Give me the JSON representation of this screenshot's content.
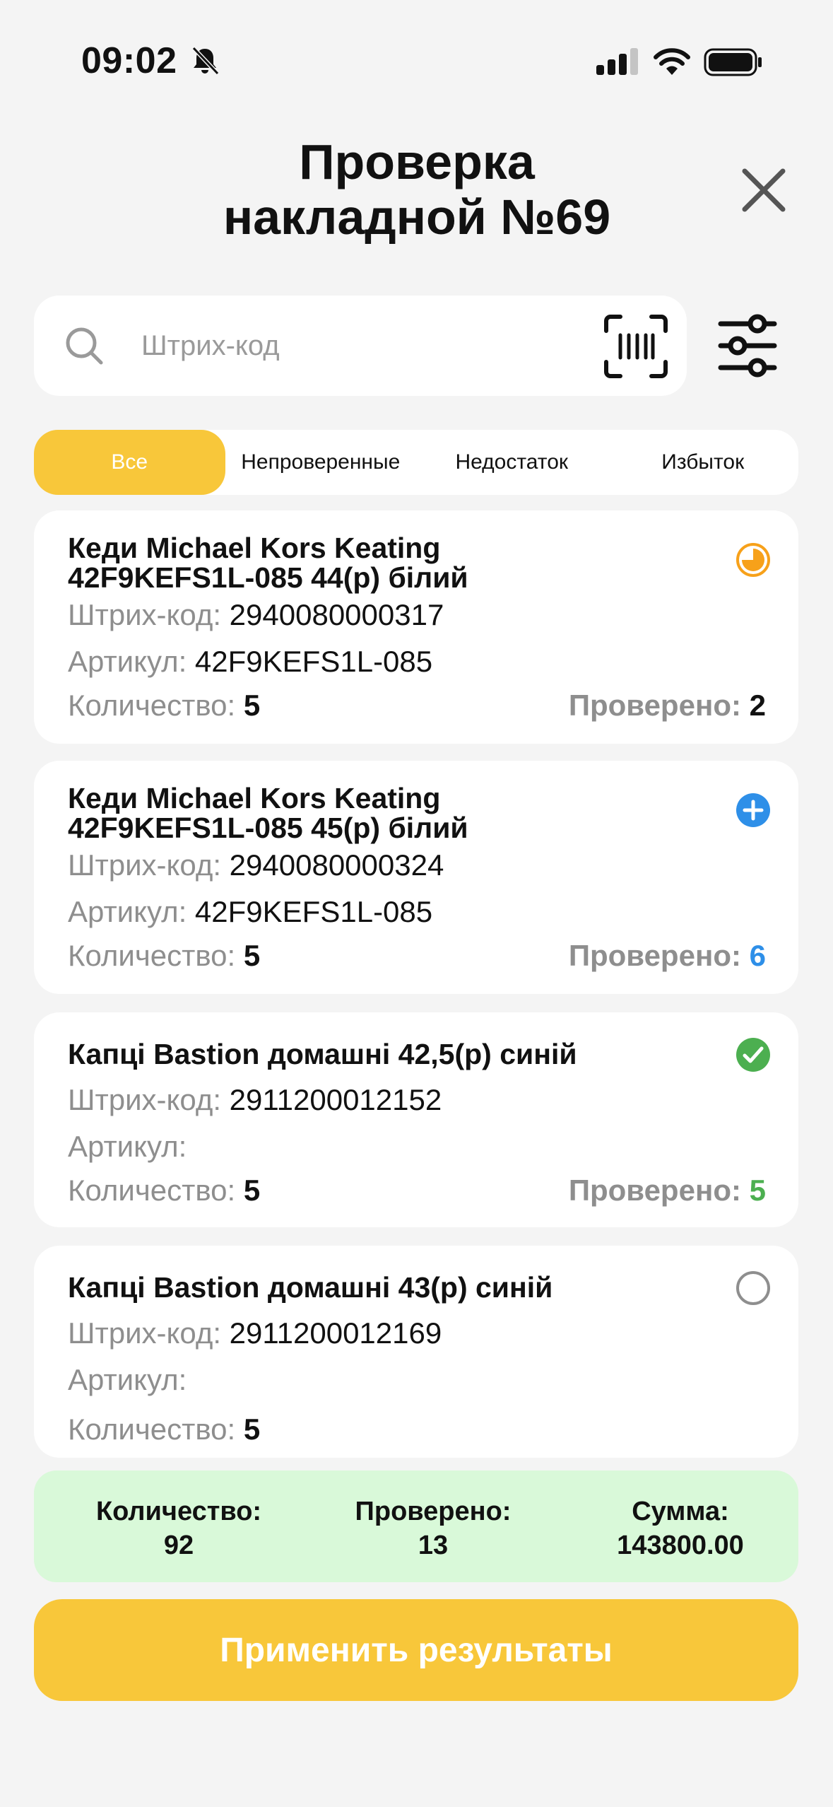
{
  "status_bar": {
    "time": "09:02"
  },
  "header": {
    "title_line1": "Проверка",
    "title_line2": "накладной №69"
  },
  "search": {
    "placeholder": "Штрих-код",
    "value": ""
  },
  "tabs": [
    {
      "label": "Все",
      "active": true
    },
    {
      "label": "Непроверенные",
      "active": false
    },
    {
      "label": "Недостаток",
      "active": false
    },
    {
      "label": "Избыток",
      "active": false
    }
  ],
  "labels": {
    "barcode": "Штрих-код:",
    "article": "Артикул:",
    "quantity": "Количество:",
    "checked": "Проверено:"
  },
  "items": [
    {
      "title_line1": "Кеди Michael Kors Keating",
      "title_line2": "42F9KEFS1L-085 44(р) білий",
      "barcode": "2940080000317",
      "article": "42F9KEFS1L-085",
      "quantity": "5",
      "checked": "2",
      "status_icon": "partial-clock-icon",
      "checked_color": "#111111"
    },
    {
      "title_line1": "Кеди Michael Kors Keating",
      "title_line2": "42F9KEFS1L-085 45(р) білий",
      "barcode": "2940080000324",
      "article": "42F9KEFS1L-085",
      "quantity": "5",
      "checked": "6",
      "status_icon": "plus-circle-icon",
      "checked_color": "#2e8fe8"
    },
    {
      "title_line1": "Капці Bastion домашні 42,5(р) синій",
      "barcode": "2911200012152",
      "article": "",
      "quantity": "5",
      "checked": "5",
      "status_icon": "check-circle-icon",
      "checked_color": "#4caf50"
    },
    {
      "title_line1": "Капці Bastion домашні 43(р) синій",
      "barcode": "2911200012169",
      "article": "",
      "quantity": "5",
      "status_icon": "empty-circle-icon"
    }
  ],
  "summary": {
    "quantity_label": "Количество:",
    "quantity_value": "92",
    "checked_label": "Проверено:",
    "checked_value": "13",
    "sum_label": "Сумма:",
    "sum_value": "143800.00"
  },
  "apply_button": {
    "label": "Применить результаты"
  },
  "colors": {
    "accent": "#f8c73a",
    "summary_bg": "#d9f9d9",
    "orange": "#f7a11a",
    "blue": "#2e8fe8",
    "green": "#4caf50"
  }
}
